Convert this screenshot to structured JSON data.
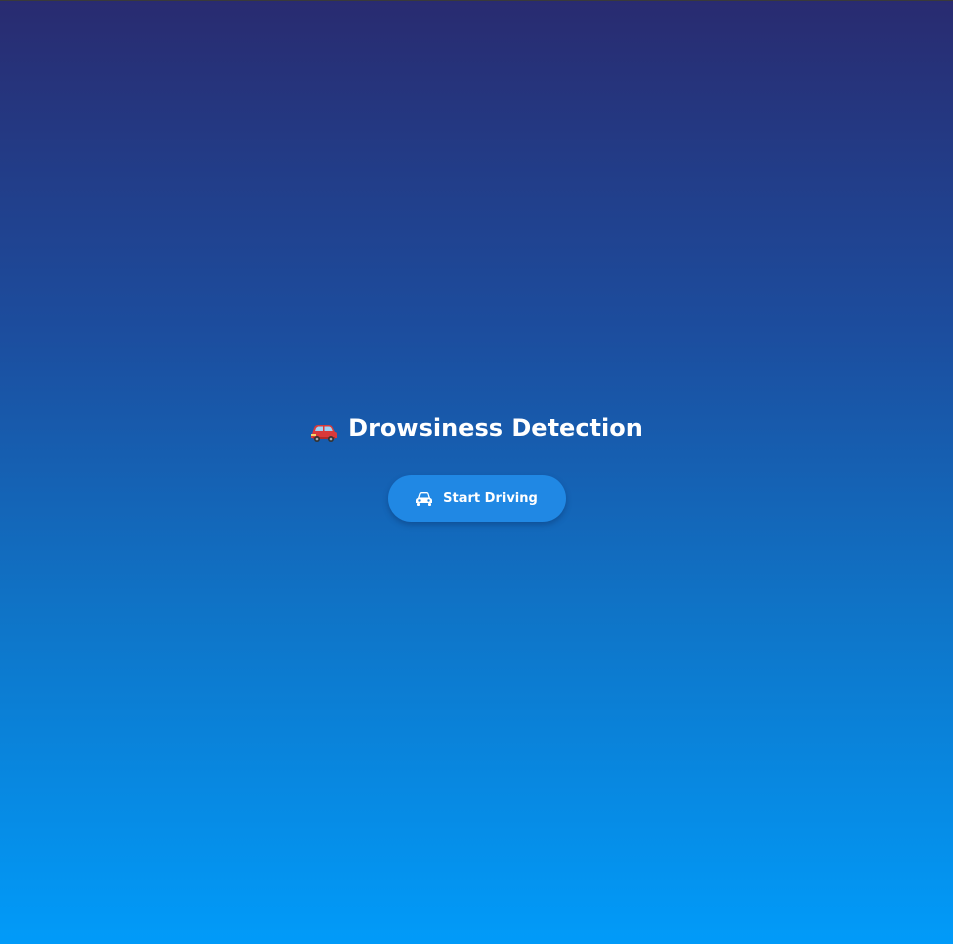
{
  "app": {
    "title": "Drowsiness Detection",
    "title_icon": "red-car-icon",
    "start_button": {
      "label": "Start Driving",
      "icon": "car-icon"
    },
    "colors": {
      "gradient_top": "#292b70",
      "gradient_bottom": "#019bf9",
      "button": "#2088e4",
      "text": "#ffffff"
    }
  }
}
